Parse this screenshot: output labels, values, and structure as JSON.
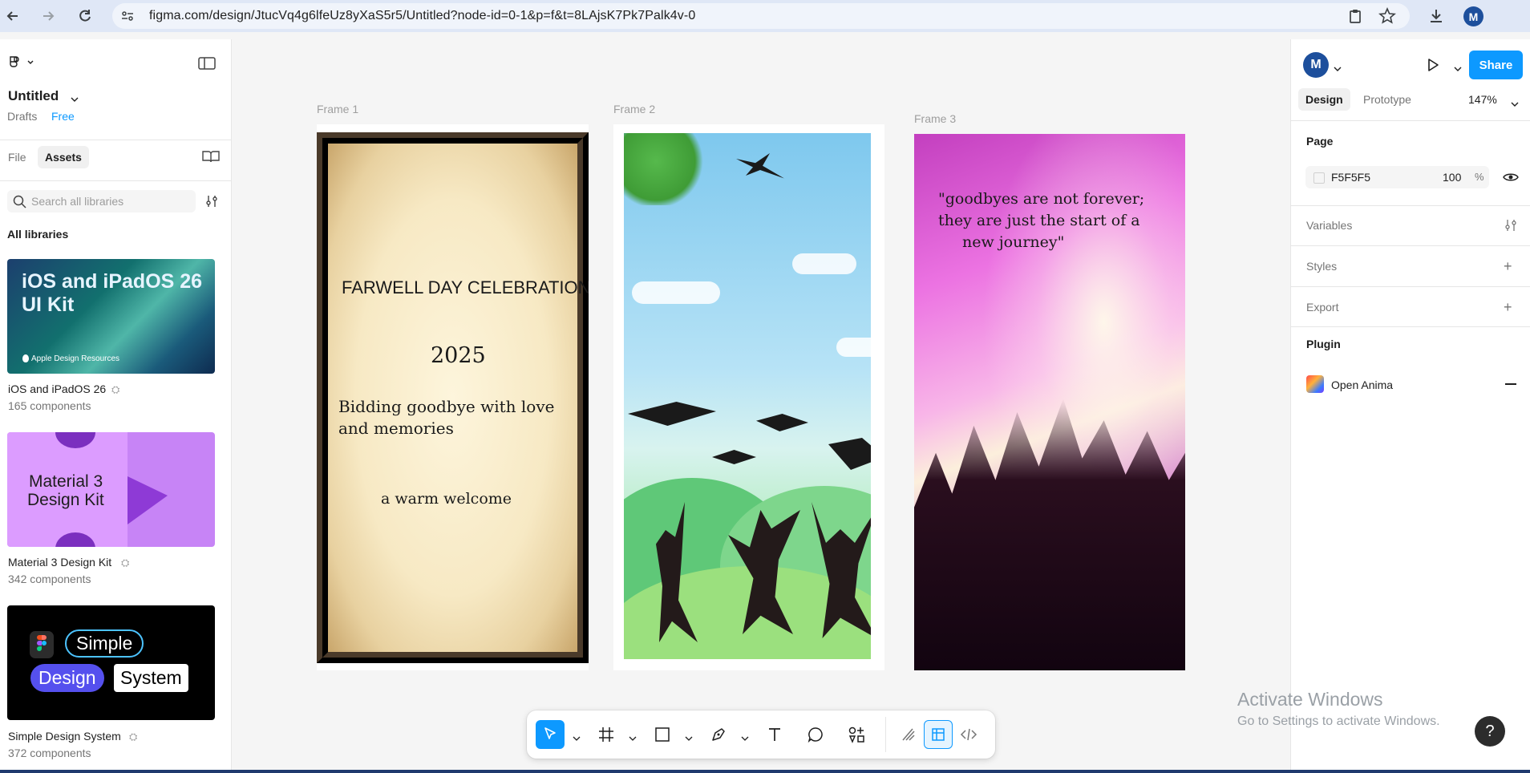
{
  "browser": {
    "url": "figma.com/design/JtucVq4g6lfeUz8yXaS5r5/Untitled?node-id=0-1&p=f&t=8LAjsK7Pk7Palk4v-0",
    "avatar": "M"
  },
  "left_panel": {
    "file_title": "Untitled",
    "drafts": "Drafts",
    "plan": "Free",
    "tabs": {
      "file": "File",
      "assets": "Assets"
    },
    "search_placeholder": "Search all libraries",
    "all_libraries": "All libraries",
    "libraries": [
      {
        "thumb_title": "iOS and iPadOS 26 UI Kit",
        "thumb_caption": "Apple Design Resources",
        "name": "iOS and iPadOS 26",
        "count": "165 components"
      },
      {
        "thumb_title_line1": "Material 3",
        "thumb_title_line2": "Design Kit",
        "name": "Material 3 Design Kit",
        "count": "342 components"
      },
      {
        "thumb_words": [
          "Simple",
          "Design",
          "System"
        ],
        "name": "Simple Design System",
        "count": "372 components"
      }
    ]
  },
  "canvas": {
    "frames": [
      {
        "label": "Frame 1",
        "title": "FARWELL DAY CELEBRATION",
        "year": "2025",
        "line1": "Bidding goodbye with love",
        "line2": "and memories",
        "welcome": "a warm welcome"
      },
      {
        "label": "Frame 2"
      },
      {
        "label": "Frame 3",
        "quote1": "\"goodbyes are not forever;",
        "quote2": "they are just the start of a",
        "quote3": "new journey\""
      }
    ]
  },
  "right_panel": {
    "avatar": "M",
    "share": "Share",
    "tabs": {
      "design": "Design",
      "prototype": "Prototype"
    },
    "zoom": "147%",
    "page_label": "Page",
    "page_color": "F5F5F5",
    "page_opacity": "100",
    "page_opacity_unit": "%",
    "variables": "Variables",
    "styles": "Styles",
    "export": "Export",
    "plugin": "Plugin",
    "plugin_name": "Open Anima"
  },
  "watermark": {
    "line1": "Activate Windows",
    "line2": "Go to Settings to activate Windows."
  },
  "help": "?"
}
